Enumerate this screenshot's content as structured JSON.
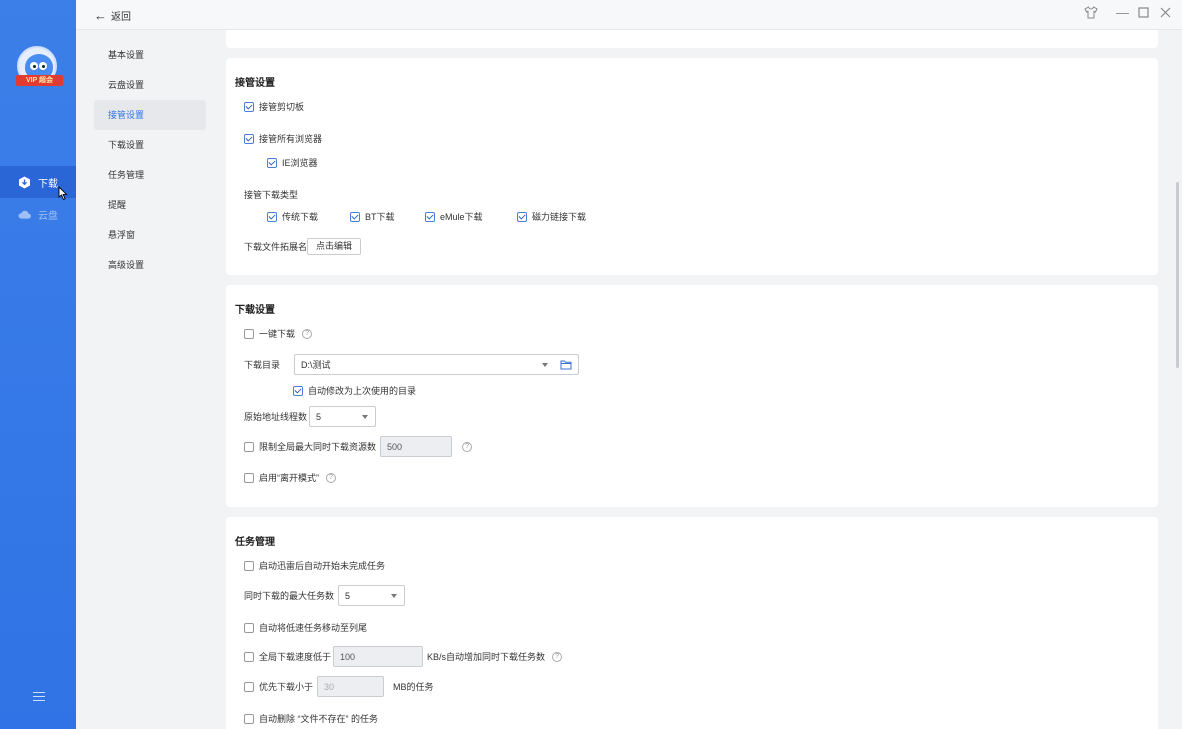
{
  "rail": {
    "vip_badge": "VIP 超会",
    "items": [
      {
        "label": "下载",
        "active": true
      },
      {
        "label": "云盘",
        "active": false
      }
    ]
  },
  "topbar": {
    "back_label": "返回"
  },
  "nav": {
    "items": [
      "基本设置",
      "云盘设置",
      "接管设置",
      "下载设置",
      "任务管理",
      "提醒",
      "悬浮窗",
      "高级设置"
    ],
    "active_index": 2
  },
  "takeover": {
    "title": "接管设置",
    "clipboard": {
      "label": "接管剪切板",
      "checked": true
    },
    "all_browsers": {
      "label": "接管所有浏览器",
      "checked": true
    },
    "ie": {
      "label": "IE浏览器",
      "checked": true
    },
    "types_label": "接管下载类型",
    "types": [
      {
        "label": "传统下载",
        "checked": true
      },
      {
        "label": "BT下载",
        "checked": true
      },
      {
        "label": "eMule下载",
        "checked": true
      },
      {
        "label": "磁力链接下载",
        "checked": true
      }
    ],
    "ext_label": "下载文件拓展名",
    "ext_button": "点击编辑"
  },
  "download": {
    "title": "下载设置",
    "one_click": {
      "label": "一键下载",
      "checked": false
    },
    "dir_label": "下载目录",
    "dir_value": "D:\\测试",
    "auto_dir": {
      "label": "自动修改为上次使用的目录",
      "checked": true
    },
    "threads_label": "原始地址线程数",
    "threads_value": "5",
    "limit": {
      "label": "限制全局最大同时下载资源数",
      "checked": false,
      "value": "500"
    },
    "away": {
      "label": "启用“离开模式”",
      "checked": false
    }
  },
  "tasks": {
    "title": "任务管理",
    "auto_start": {
      "label": "启动迅雷后自动开始未完成任务",
      "checked": false
    },
    "max_tasks_label": "同时下载的最大任务数",
    "max_tasks_value": "5",
    "move_slow": {
      "label": "自动将低速任务移动至列尾",
      "checked": false
    },
    "speed_low": {
      "label": "全局下载速度低于",
      "value": "100",
      "suffix": "KB/s自动增加同时下载任务数",
      "checked": false
    },
    "prefer_small": {
      "label": "优先下载小于",
      "value": "30",
      "suffix": "MB的任务",
      "checked": false
    },
    "auto_delete": {
      "label": "自动删除 “文件不存在” 的任务",
      "checked": false
    }
  }
}
